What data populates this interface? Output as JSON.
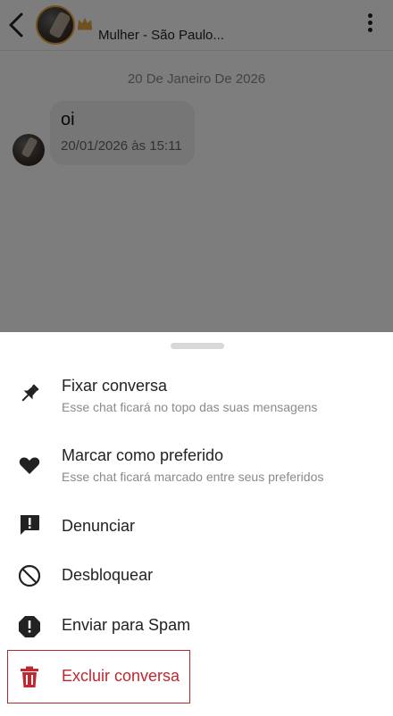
{
  "chat": {
    "header_subtitle": "Mulher - São Paulo...",
    "date_separator": "20 De Janeiro De 2026",
    "message_text": "oi",
    "message_time": "20/01/2026 às 15:11"
  },
  "icons": {
    "back": "chevron-left-icon",
    "crown": "crown-icon",
    "more": "kebab-icon",
    "pin": "pin-icon",
    "favorite": "heart-icon",
    "report": "report-icon",
    "unblock": "block-icon",
    "spam": "spam-icon",
    "delete": "trash-icon"
  },
  "colors": {
    "accent_gold": "#e3a33a",
    "danger": "#c2262e",
    "overlay": "rgba(0,0,0,0.5)"
  },
  "sheet": {
    "items": [
      {
        "title": "Fixar conversa",
        "description": "Esse chat ficará no topo das suas mensagens"
      },
      {
        "title": "Marcar como preferido",
        "description": "Esse chat ficará marcado entre seus preferidos"
      },
      {
        "title": "Denunciar"
      },
      {
        "title": "Desbloquear"
      },
      {
        "title": "Enviar para Spam"
      },
      {
        "title": "Excluir conversa"
      }
    ]
  }
}
